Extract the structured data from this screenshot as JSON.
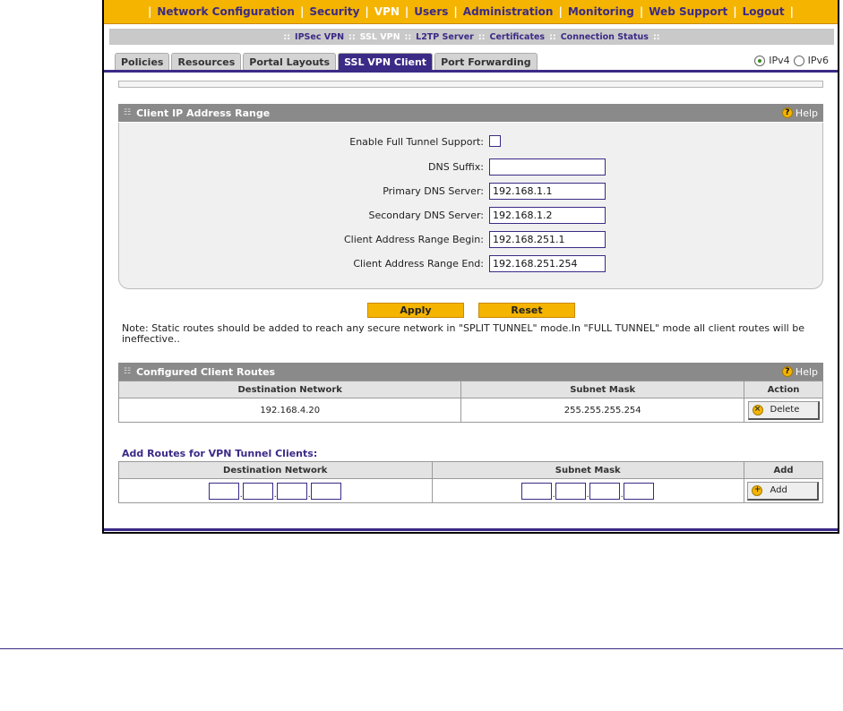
{
  "top_nav": [
    "Network Configuration",
    "Security",
    "VPN",
    "Users",
    "Administration",
    "Monitoring",
    "Web Support",
    "Logout"
  ],
  "sub_nav": [
    "IPSec VPN",
    "SSL VPN",
    "L2TP Server",
    "Certificates",
    "Connection Status"
  ],
  "tabs": [
    "Policies",
    "Resources",
    "Portal Layouts",
    "SSL VPN Client",
    "Port Forwarding"
  ],
  "ip_mode": {
    "ipv4": "IPv4",
    "ipv6": "IPv6",
    "selected": "IPv4"
  },
  "client_ip": {
    "title": "Client IP Address Range",
    "help": "Help",
    "enable_full_tunnel_label": "Enable Full Tunnel Support:",
    "dns_suffix_label": "DNS Suffix:",
    "dns_suffix_value": "",
    "primary_dns_label": "Primary DNS Server:",
    "primary_dns_value": "192.168.1.1",
    "secondary_dns_label": "Secondary DNS Server:",
    "secondary_dns_value": "192.168.1.2",
    "range_begin_label": "Client Address Range Begin:",
    "range_begin_value": "192.168.251.1",
    "range_end_label": "Client Address Range End:",
    "range_end_value": "192.168.251.254"
  },
  "buttons": {
    "apply": "Apply",
    "reset": "Reset"
  },
  "note": "Note: Static routes should be added to reach any secure network in \"SPLIT TUNNEL\" mode.In \"FULL TUNNEL\" mode all client routes will be ineffective..",
  "routes": {
    "title": "Configured Client Routes",
    "help": "Help",
    "headers": [
      "Destination Network",
      "Subnet Mask",
      "Action"
    ],
    "rows": [
      {
        "destination": "192.168.4.20",
        "mask": "255.255.255.254",
        "action": "Delete"
      }
    ]
  },
  "add_routes": {
    "title": "Add Routes for VPN Tunnel Clients:",
    "headers": [
      "Destination Network",
      "Subnet Mask",
      "Add"
    ],
    "add_label": "Add"
  },
  "colors": {
    "accent": "#f5b400",
    "brand": "#3b2a86",
    "header": "#8a8a8a"
  }
}
